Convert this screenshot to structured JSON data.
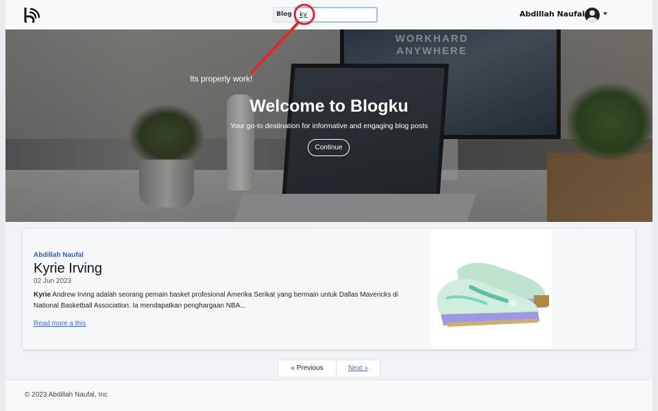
{
  "navbar": {
    "search_label": "Blog",
    "search_value": "ky",
    "username": "Abdillah Naufal"
  },
  "hero": {
    "monitor_text": "WORKHARD ANYWHERE",
    "title": "Welcome to Blogku",
    "subtitle": "Your go-to destination for informative and engaging blog posts",
    "button_label": "Continue"
  },
  "annotation": {
    "text": "Its properly work!",
    "color": "#e8232a"
  },
  "post": {
    "author": "Abdillah Naufal",
    "title": "Kyrie Irving",
    "date": "02 Jun 2023",
    "body_bold": "Kyrie",
    "body_text": " Andrew Irving adalah seorang pemain basket profesional Amerika Serikat yang bermain untuk Dallas Mavericks di National Basketball Association. Ia mendapatkan penghargaan NBA...",
    "read_more": "Read more a this"
  },
  "pagination": {
    "prev_label": "« Previous",
    "next_label": "Next »"
  },
  "footer": {
    "copyright": "© 2023 Abdillah Naufal, Inc"
  },
  "colors": {
    "accent": "#4169e1",
    "author": "#3b5fc0",
    "search_focus": "#9ec0f5"
  }
}
